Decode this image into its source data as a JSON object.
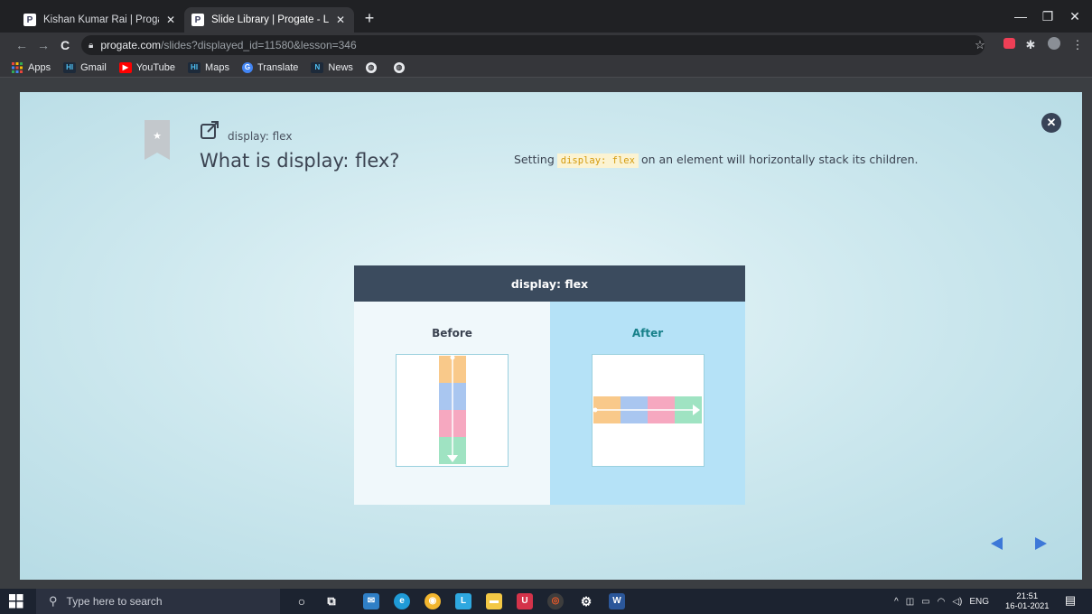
{
  "browser": {
    "tabs": [
      {
        "favicon": "P",
        "title": "Kishan Kumar Rai | Progate - Lea",
        "close": "✕"
      },
      {
        "favicon": "P",
        "title": "Slide Library | Progate - Learn to",
        "close": "✕"
      }
    ],
    "new_tab": "+",
    "window_controls": {
      "minimize": "—",
      "maximize": "❐",
      "close": "✕"
    },
    "nav": {
      "back": "←",
      "forward": "→",
      "reload": "C"
    },
    "url_host": "progate.com",
    "url_path": "/slides?displayed_id=11580&lesson=346",
    "toolbar_icons": [
      "star-icon",
      "pocket-icon",
      "extensions-icon",
      "profile-icon",
      "menu-icon"
    ]
  },
  "bookmarks": [
    {
      "icon": "apps-icon",
      "label": "Apps",
      "color": "#e8453c"
    },
    {
      "icon": "gmail-icon",
      "label": "Gmail",
      "color": "#1d2a3a"
    },
    {
      "icon": "youtube-icon",
      "label": "YouTube",
      "color": "#ff0000"
    },
    {
      "icon": "maps-icon",
      "label": "Maps",
      "color": "#1d2a3a"
    },
    {
      "icon": "translate-icon",
      "label": "Translate",
      "color": "#4285f4"
    },
    {
      "icon": "news-icon",
      "label": "News",
      "color": "#1d2a3a"
    },
    {
      "icon": "globe-icon",
      "label": ""
    },
    {
      "icon": "globe-icon",
      "label": ""
    }
  ],
  "slide": {
    "subtitle": "display: flex",
    "title": "What is display: flex?",
    "desc_before": "Setting",
    "desc_code": "display: flex",
    "desc_after": "on an element will horizontally stack its children.",
    "figure": {
      "header": "display: flex",
      "before_label": "Before",
      "after_label": "After",
      "item_colors": [
        "#f9c98a",
        "#a9c6f0",
        "#f6a8c0",
        "#9fe3c2"
      ]
    }
  },
  "taskbar": {
    "search_placeholder": "Type here to search",
    "tray_lang": "ENG",
    "time": "21:51",
    "date": "16-01-2021"
  }
}
